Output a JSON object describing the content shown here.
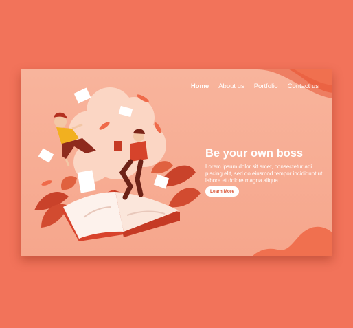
{
  "nav": {
    "items": [
      {
        "label": "Home",
        "active": true
      },
      {
        "label": "About us",
        "active": false
      },
      {
        "label": "Portfolio",
        "active": false
      },
      {
        "label": "Contact us",
        "active": false
      }
    ]
  },
  "hero": {
    "title": "Be your own boss",
    "text": "Lorem ipsum dolor sit amet, consectetur adi piscing elit, sed do eiusmod tempor incididunt ut labore et dolore magna aliqua.",
    "button_label": "Learn More"
  },
  "colors": {
    "background": "#f2735a",
    "card": "#f8b49c",
    "accent": "#e8593d"
  }
}
